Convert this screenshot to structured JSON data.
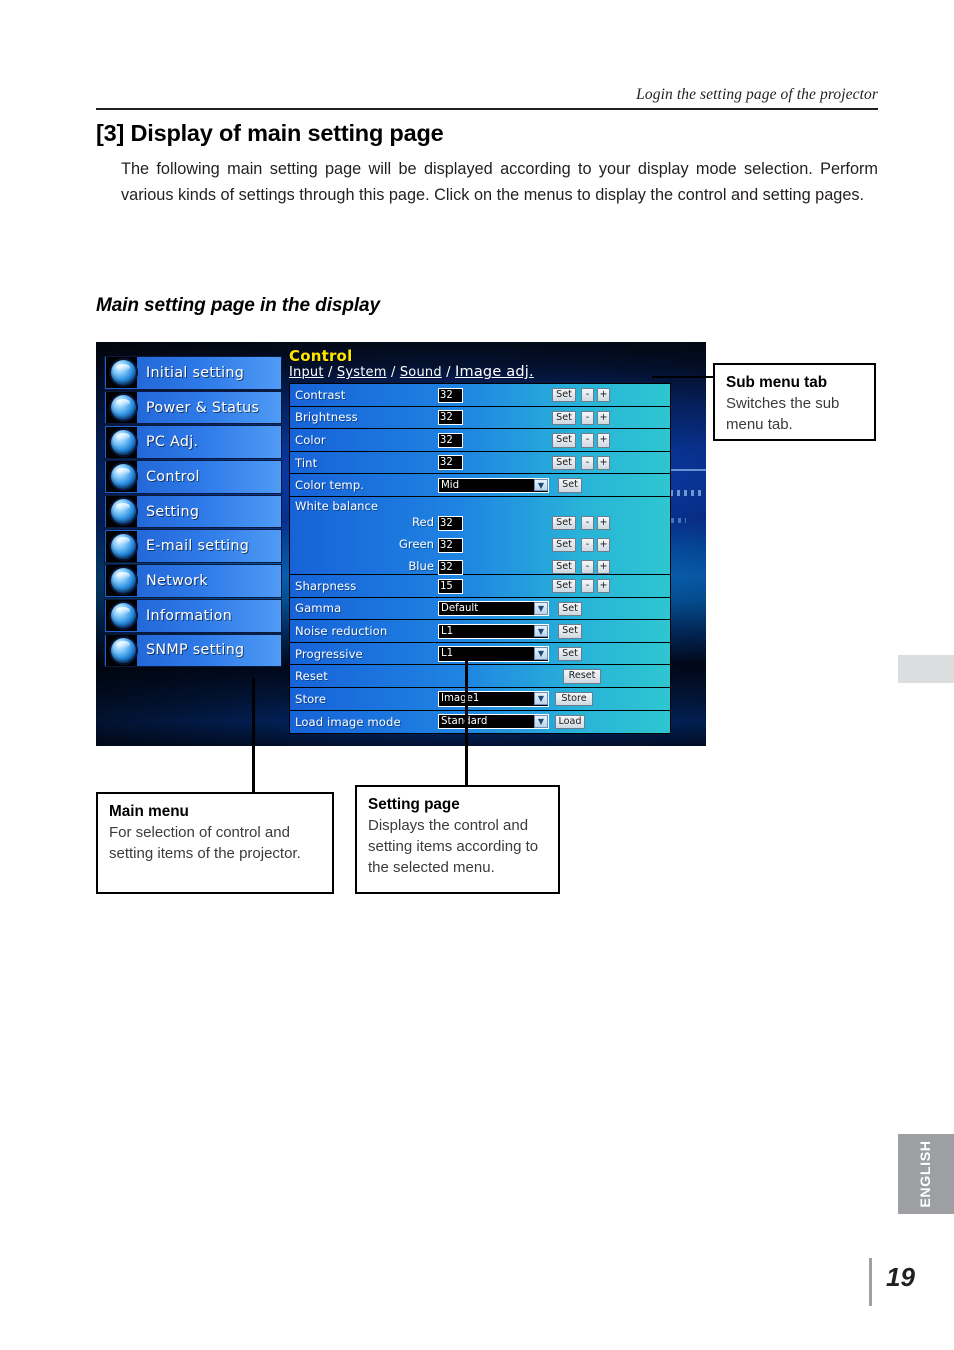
{
  "running_head": "Login the setting page of the projector",
  "section": {
    "number": "[3]",
    "title": "Display of main setting page",
    "body": "The following main setting page will be displayed according to your display mode selection. Perform various kinds of settings through this page. Click on the menus to display the control and setting pages.",
    "subheading": "Main setting page in the display"
  },
  "screenshot": {
    "main_menu": [
      {
        "label": "Initial setting",
        "icon": "initial-setting-icon"
      },
      {
        "label": "Power & Status",
        "icon": "power-status-icon"
      },
      {
        "label": "PC Adj.",
        "icon": "pc-adj-icon"
      },
      {
        "label": "Control",
        "icon": "control-icon"
      },
      {
        "label": "Setting",
        "icon": "setting-icon"
      },
      {
        "label": "E-mail setting",
        "icon": "email-icon"
      },
      {
        "label": "Network",
        "icon": "network-icon"
      },
      {
        "label": "Information",
        "icon": "information-icon"
      },
      {
        "label": "SNMP setting",
        "icon": "snmp-icon"
      }
    ],
    "panel": {
      "title": "Control",
      "title_color": "#ffe600",
      "tabs": [
        {
          "label": "Input",
          "selected": false
        },
        {
          "label": "System",
          "selected": false
        },
        {
          "label": "Sound",
          "selected": false
        },
        {
          "label": "Image adj.",
          "selected": true
        }
      ],
      "tab_separator": " / ",
      "rows": [
        {
          "label": "Contrast",
          "type": "number",
          "value": "32",
          "buttons": [
            "Set",
            "-",
            "+"
          ]
        },
        {
          "label": "Brightness",
          "type": "number",
          "value": "32",
          "buttons": [
            "Set",
            "-",
            "+"
          ]
        },
        {
          "label": "Color",
          "type": "number",
          "value": "32",
          "buttons": [
            "Set",
            "-",
            "+"
          ]
        },
        {
          "label": "Tint",
          "type": "number",
          "value": "32",
          "buttons": [
            "Set",
            "-",
            "+"
          ]
        },
        {
          "label": "Color temp.",
          "type": "dropdown",
          "value": "Mid",
          "buttons": [
            "Set"
          ]
        },
        {
          "label": "Sharpness",
          "type": "number",
          "value": "15",
          "buttons": [
            "Set",
            "-",
            "+"
          ]
        },
        {
          "label": "Gamma",
          "type": "dropdown",
          "value": "Default",
          "buttons": [
            "Set"
          ]
        },
        {
          "label": "Noise reduction",
          "type": "dropdown",
          "value": "L1",
          "buttons": [
            "Set"
          ]
        },
        {
          "label": "Progressive",
          "type": "dropdown",
          "value": "L1",
          "buttons": [
            "Set"
          ]
        },
        {
          "label": "Reset",
          "type": "action",
          "value": "",
          "buttons": [
            "Reset"
          ]
        },
        {
          "label": "Store",
          "type": "dropdown",
          "value": "Image1",
          "buttons": [
            "Store"
          ]
        },
        {
          "label": "Load image mode",
          "type": "dropdown",
          "value": "Standard",
          "buttons": [
            "Load"
          ]
        }
      ],
      "white_balance": {
        "label": "White balance",
        "channels": [
          {
            "label": "Red",
            "value": "32",
            "buttons": [
              "Set",
              "-",
              "+"
            ]
          },
          {
            "label": "Green",
            "value": "32",
            "buttons": [
              "Set",
              "-",
              "+"
            ]
          },
          {
            "label": "Blue",
            "value": "32",
            "buttons": [
              "Set",
              "-",
              "+"
            ]
          }
        ]
      }
    }
  },
  "callouts": {
    "sub_menu_tab": {
      "title": "Sub menu tab",
      "text": "Switches the sub menu tab."
    },
    "main_menu": {
      "title": "Main menu",
      "text": "For selection of  control and setting items of the projector."
    },
    "setting_page": {
      "title": "Setting page",
      "text": "Displays the control and setting items according to the selected menu."
    }
  },
  "footer": {
    "language": "ENGLISH",
    "page_number": "19"
  }
}
